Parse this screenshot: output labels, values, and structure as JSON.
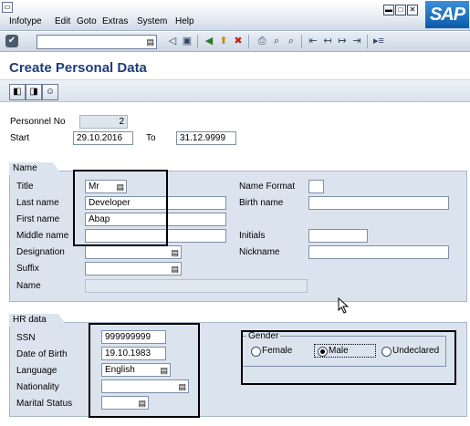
{
  "menu": {
    "items": [
      "Infotype",
      "Edit",
      "Goto",
      "Extras",
      "System",
      "Help"
    ],
    "logo": "SAP"
  },
  "toolbar": {
    "command_value": "",
    "icons": [
      "ok-icon",
      "back-icon",
      "save-icon",
      "exit-icon",
      "cancel-icon",
      "print-icon",
      "find-icon",
      "find-next-icon",
      "first-page-icon",
      "prev-page-icon",
      "next-page-icon",
      "last-page-icon",
      "help-icon"
    ]
  },
  "page": {
    "title": "Create Personal Data"
  },
  "header": {
    "personnel_no_label": "Personnel No",
    "personnel_no_value": "2",
    "start_label": "Start",
    "start_value": "29.10.2016",
    "to_label": "To",
    "to_value": "31.12.9999"
  },
  "name_group": {
    "title": "Name",
    "title_label": "Title",
    "title_value": "Mr",
    "last_name_label": "Last name",
    "last_name_value": "Developer",
    "first_name_label": "First name",
    "first_name_value": "Abap",
    "middle_name_label": "Middle name",
    "middle_name_value": "",
    "designation_label": "Designation",
    "designation_value": "",
    "suffix_label": "Suffix",
    "suffix_value": "",
    "name_label": "Name",
    "name_value": "",
    "name_format_label": "Name Format",
    "name_format_value": "",
    "birth_name_label": "Birth name",
    "birth_name_value": "",
    "initials_label": "Initials",
    "initials_value": "",
    "nickname_label": "Nickname",
    "nickname_value": ""
  },
  "hr_group": {
    "title": "HR data",
    "ssn_label": "SSN",
    "ssn_value": "999999999",
    "dob_label": "Date of Birth",
    "dob_value": "19.10.1983",
    "language_label": "Language",
    "language_value": "English",
    "nationality_label": "Nationality",
    "nationality_value": "",
    "marital_label": "Marital Status",
    "marital_value": ""
  },
  "gender": {
    "title": "Gender",
    "female": "Female",
    "male": "Male",
    "undeclared": "Undeclared",
    "selected": "Male"
  }
}
